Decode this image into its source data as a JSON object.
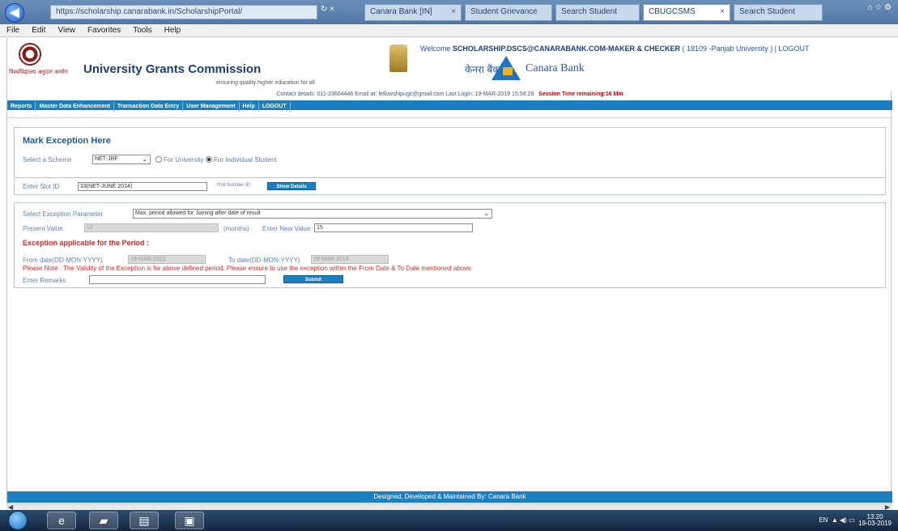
{
  "browser": {
    "address": "https://scholarship.canarabank.in/ScholarshipPortal/",
    "address_controls": "↻ ×",
    "tabs": [
      {
        "label": "Canara Bank [IN]"
      },
      {
        "label": "Student Grievance"
      },
      {
        "label": "Search Student"
      },
      {
        "label": "CBUGCSMS"
      },
      {
        "label": "Search Student"
      }
    ],
    "window_controls": "⌂ ☆ ⚙",
    "menu": [
      "File",
      "Edit",
      "View",
      "Favorites",
      "Tools",
      "Help"
    ]
  },
  "header": {
    "logo_caption": "विश्वविद्यालय अनुदान आयोग",
    "title": "University Grants Commission",
    "tagline": "ensuring quality higher education for all",
    "welcome_prefix": "Welcome",
    "welcome_user": "SCHOLARSHIP.DSCS@CANARABANK.COM-MAKER & CHECKER",
    "welcome_suffix": "( 18109 -Panjab University ) | LOGOUT",
    "bank_hindi": "केनरा बैंक",
    "bank_name": "Canara Bank"
  },
  "contact": {
    "text": "Contact details: 011-23604446   Email at: fellowshipugc@gmail.com   Last Login: 19-MAR-2019 15:58:29",
    "session": "Session Time remaining:16 Min"
  },
  "nav": [
    "Reports",
    "Master Data Enhancement",
    "Transaction Data Entry",
    "User Management",
    "Help",
    "LOGOUT"
  ],
  "form": {
    "title": "Mark Exception Here",
    "scheme_label": "Select a Scheme",
    "scheme_value": "NET-JRF",
    "radio_university": "For University",
    "radio_individual": "For Individual Student",
    "slot_label": "Enter Slot ID",
    "slot_value": "33(NET-JUNE 2014)",
    "roll_label": "Roll Number ID",
    "show_details": "Show Details",
    "param_label": "Select Exception Parameter",
    "param_value": "Max. period allowed for Joining after date of result",
    "present_label": "Present Value",
    "present_value": "12",
    "months_label": "(months)",
    "new_value_label": "Enter New Value",
    "new_value": "15",
    "period_title": "Exception applicable for the Period :",
    "from_label": "From date(DD-MON-YYYY)",
    "from_value": "19-MAR-2019",
    "to_label": "To date(DD-MON-YYYY)",
    "to_value": "19-MAR-2019",
    "note": "Please Note : The Validity of the Exception is for above defined period. Please ensure to use the exception within the From Date & To Date mentioned above.",
    "remarks_label": "Enter Remarks",
    "submit": "Submit"
  },
  "footer": "Designed, Developed & Maintained By: Canara Bank",
  "taskbar": {
    "icons": [
      "ie-icon",
      "folder-icon",
      "file-icon",
      "window-icon"
    ],
    "lang": "EN",
    "time": "13:20",
    "date": "19-03-2019"
  },
  "colors": {
    "accent": "#1b7fc0",
    "heading": "#1c5aa8",
    "error": "#d42a2a"
  }
}
